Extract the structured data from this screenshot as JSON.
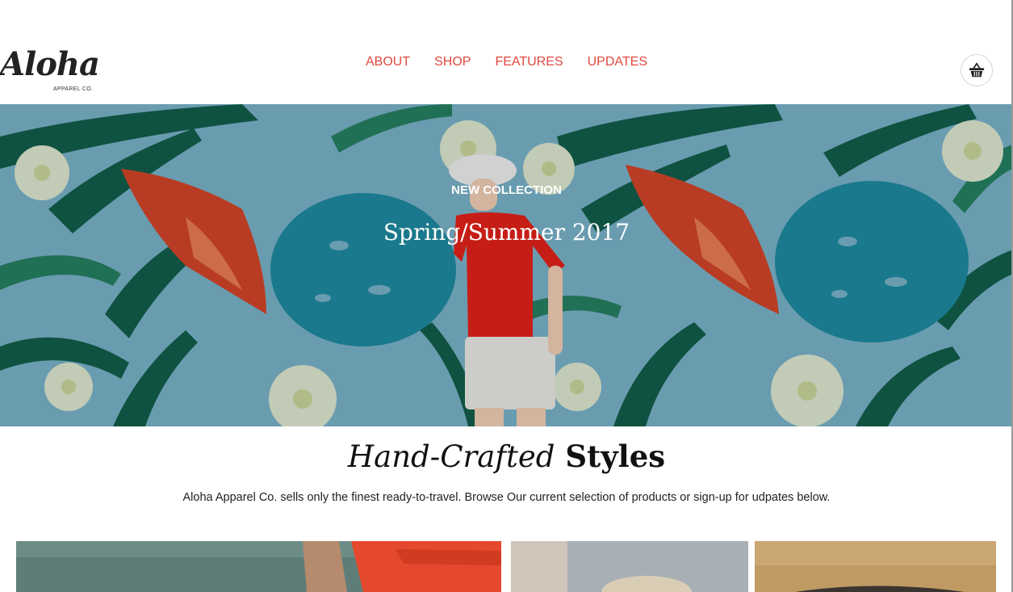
{
  "brand": {
    "name": "Aloha",
    "tagline": "APPAREL CO."
  },
  "nav": {
    "items": [
      {
        "label": "ABOUT"
      },
      {
        "label": "SHOP"
      },
      {
        "label": "FEATURES"
      },
      {
        "label": "UPDATES"
      }
    ]
  },
  "cart": {
    "icon": "basket-icon"
  },
  "hero": {
    "eyebrow": "NEW COLLECTION",
    "title": "Spring/Summer 2017"
  },
  "section": {
    "heading_italic": "Hand-Crafted",
    "heading_bold": "Styles",
    "description": "Aloha Apparel Co. sells only the finest ready-to-travel. Browse Our current selection of products or sign-up for udpates below."
  },
  "colors": {
    "accent": "#e0483f",
    "hero_background": "#78b1c8",
    "text": "#111111"
  }
}
